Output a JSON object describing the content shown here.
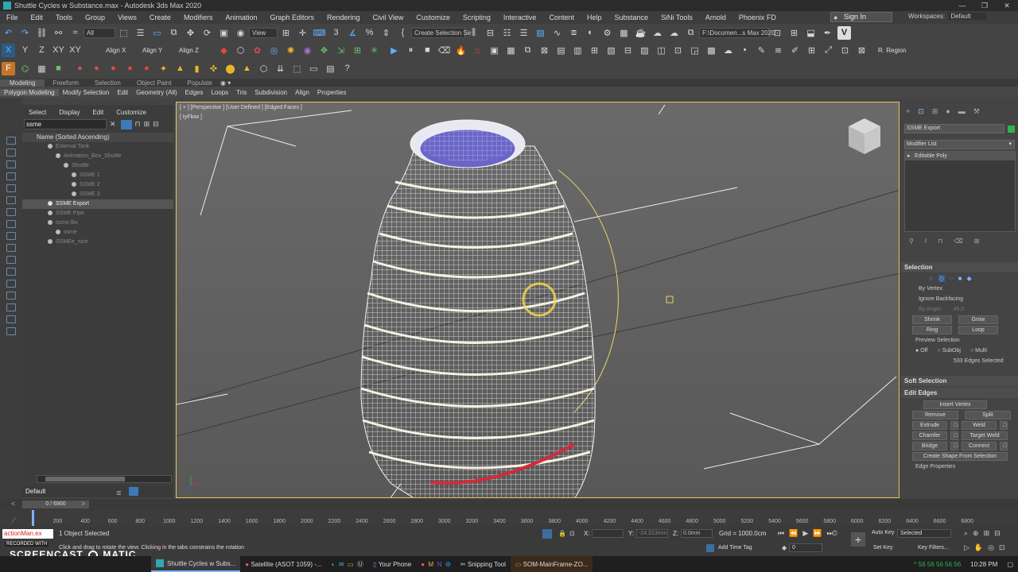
{
  "window": {
    "title": "Shuttle Cycles w Substance.max - Autodesk 3ds Max 2020",
    "minimize": "—",
    "maximize": "❐",
    "close": "✕"
  },
  "menu": [
    "File",
    "Edit",
    "Tools",
    "Group",
    "Views",
    "Create",
    "Modifiers",
    "Animation",
    "Graph Editors",
    "Rendering",
    "Civil View",
    "Customize",
    "Scripting",
    "Interactive",
    "Content",
    "Help",
    "Substance",
    "SiNi Tools",
    "Arnold",
    "Phoenix FD"
  ],
  "signin": "Sign In",
  "workspaces": {
    "label": "Workspaces:",
    "value": "Default"
  },
  "toolbar1": {
    "filter": "All",
    "refcoord": "View",
    "selset": "Create Selection Se",
    "path": "F:\\Documen...s Max 2020"
  },
  "toolbar2": {
    "align_x": "Align X",
    "align_y": "Align Y",
    "align_z": "Align Z",
    "region": "R. Region"
  },
  "ribbon_tabs": [
    "Modeling",
    "Freeform",
    "Selection",
    "Object Paint",
    "Populate"
  ],
  "ribbon_tools": [
    "Polygon Modeling",
    "Modify Selection",
    "Edit",
    "Geometry (All)",
    "Edges",
    "Loops",
    "Tris",
    "Subdivision",
    "Align",
    "Properties"
  ],
  "explorer": {
    "tabs": [
      "Select",
      "Display",
      "Edit",
      "Customize"
    ],
    "search": "ssme",
    "header": "Name (Sorted Ascending)",
    "rows": [
      {
        "label": "External Tank",
        "indent": 1
      },
      {
        "label": "Animation_Box_Shuttle",
        "indent": 2
      },
      {
        "label": "Shuttle",
        "indent": 3
      },
      {
        "label": "SSME 1",
        "indent": 4
      },
      {
        "label": "SSME 2",
        "indent": 4
      },
      {
        "label": "SSME 3",
        "indent": 4
      },
      {
        "label": "SSME Export",
        "indent": 1,
        "selected": true
      },
      {
        "label": "SSME Pipe",
        "indent": 1
      },
      {
        "label": "ssme.fbx",
        "indent": 1
      },
      {
        "label": "ssme",
        "indent": 2
      },
      {
        "label": "SSMEe_nice",
        "indent": 1
      }
    ],
    "layer": "Default"
  },
  "viewport": {
    "label": "[ + ] [Perspective ] [User Defined ] [Edged Faces ]",
    "sublabel": "[ tyFlow ]"
  },
  "cmdpanel": {
    "object_name": "SSME Export",
    "modifier_list": "Modifier List",
    "stack_item": "Editable Poly",
    "selection_title": "Selection",
    "by_vertex": "By Vertex",
    "ignore_backfacing": "Ignore Backfacing",
    "by_angle": "By Angle:",
    "angle_value": "45.0",
    "shrink": "Shrink",
    "grow": "Grow",
    "ring": "Ring",
    "loop": "Loop",
    "preview_selection": "Preview Selection",
    "off": "Off",
    "subobj": "SubObj",
    "multi": "Multi",
    "selected_count": "533 Edges Selected",
    "soft_selection": "Soft Selection",
    "edit_edges": "Edit Edges",
    "insert_vertex": "Insert Vertex",
    "remove": "Remove",
    "split": "Split",
    "extrude": "Extrude",
    "weld": "Weld",
    "chamfer": "Chamfer",
    "target_weld": "Target Weld",
    "bridge": "Bridge",
    "connect": "Connect",
    "create_shape": "Create Shape From Selection",
    "edge_properties": "Edge Properties"
  },
  "timeline": {
    "frame": "0 / 6900"
  },
  "ruler_ticks": [
    "0",
    "200",
    "400",
    "600",
    "800",
    "1000",
    "1200",
    "1400",
    "1600",
    "1800",
    "2000",
    "2200",
    "2400",
    "2600",
    "2800",
    "3000",
    "3200",
    "3400",
    "3600",
    "3800",
    "4000",
    "4200",
    "4400",
    "4600",
    "4800",
    "5000",
    "5200",
    "5400",
    "5600",
    "5800",
    "6000",
    "6200",
    "6400",
    "6600",
    "6800"
  ],
  "status": {
    "objects": "1 Object Selected",
    "prompt": "Click and drag to rotate the view.  Clicking in the tabs constrains the rotation",
    "x_label": "X:",
    "y_label": "Y:",
    "z_label": "Z:",
    "y_value": "-24.313mm",
    "z_value": "0.0mm",
    "grid": "Grid = 1000.0cm",
    "add_time_tag": "Add Time Tag",
    "auto_key": "Auto Key",
    "set_key": "Set Key",
    "selected": "Selected",
    "key_filters": "Key Filters...",
    "frame_value": "0",
    "maxscript": "actionMan.ex"
  },
  "watermark": {
    "recorded": "RECORDED WITH",
    "brand": "SCREENCAST",
    "brand2": "MATIC"
  },
  "taskbar": {
    "items": [
      "Shuttle Cycles w Subs...",
      "Satellite (ASOT 1059) -...",
      "Your Phone",
      "Snipping Tool",
      "SOM-MainFrame-ZO..."
    ],
    "clock": "10:28 PM",
    "tray": "^  56  56  56  56  56"
  }
}
